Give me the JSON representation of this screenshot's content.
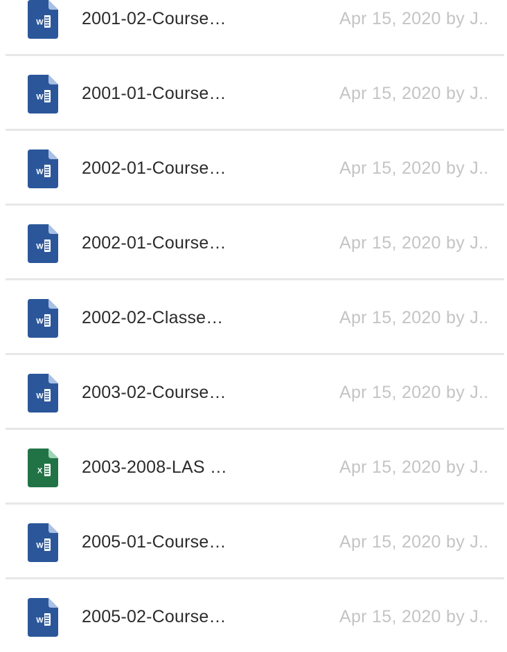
{
  "files": [
    {
      "name": "2001-02-Course…",
      "meta": "Apr 15, 2020 by J..",
      "type": "word",
      "icon": "word-doc-icon"
    },
    {
      "name": "2001-01-Course…",
      "meta": "Apr 15, 2020 by J..",
      "type": "word",
      "icon": "word-doc-icon"
    },
    {
      "name": "2002-01-Course…",
      "meta": "Apr 15, 2020 by J..",
      "type": "word",
      "icon": "word-doc-icon"
    },
    {
      "name": "2002-01-Course…",
      "meta": "Apr 15, 2020 by J..",
      "type": "word",
      "icon": "word-doc-icon"
    },
    {
      "name": "2002-02-Classe…",
      "meta": "Apr 15, 2020 by J..",
      "type": "word",
      "icon": "word-doc-icon"
    },
    {
      "name": "2003-02-Course…",
      "meta": "Apr 15, 2020 by J..",
      "type": "word",
      "icon": "word-doc-icon"
    },
    {
      "name": "2003-2008-LAS …",
      "meta": "Apr 15, 2020 by J..",
      "type": "excel",
      "icon": "excel-sheet-icon"
    },
    {
      "name": "2005-01-Course…",
      "meta": "Apr 15, 2020 by J..",
      "type": "word",
      "icon": "word-doc-icon"
    },
    {
      "name": "2005-02-Course…",
      "meta": "Apr 15, 2020 by J..",
      "type": "word",
      "icon": "word-doc-icon"
    }
  ],
  "colors": {
    "word": "#2b579a",
    "word_fold": "#a9c0e4",
    "excel": "#217346",
    "excel_fold": "#9fd5b5",
    "name_text": "#2b2b2b",
    "meta_text": "#c4c4c4",
    "divider": "#e7e7e7"
  }
}
